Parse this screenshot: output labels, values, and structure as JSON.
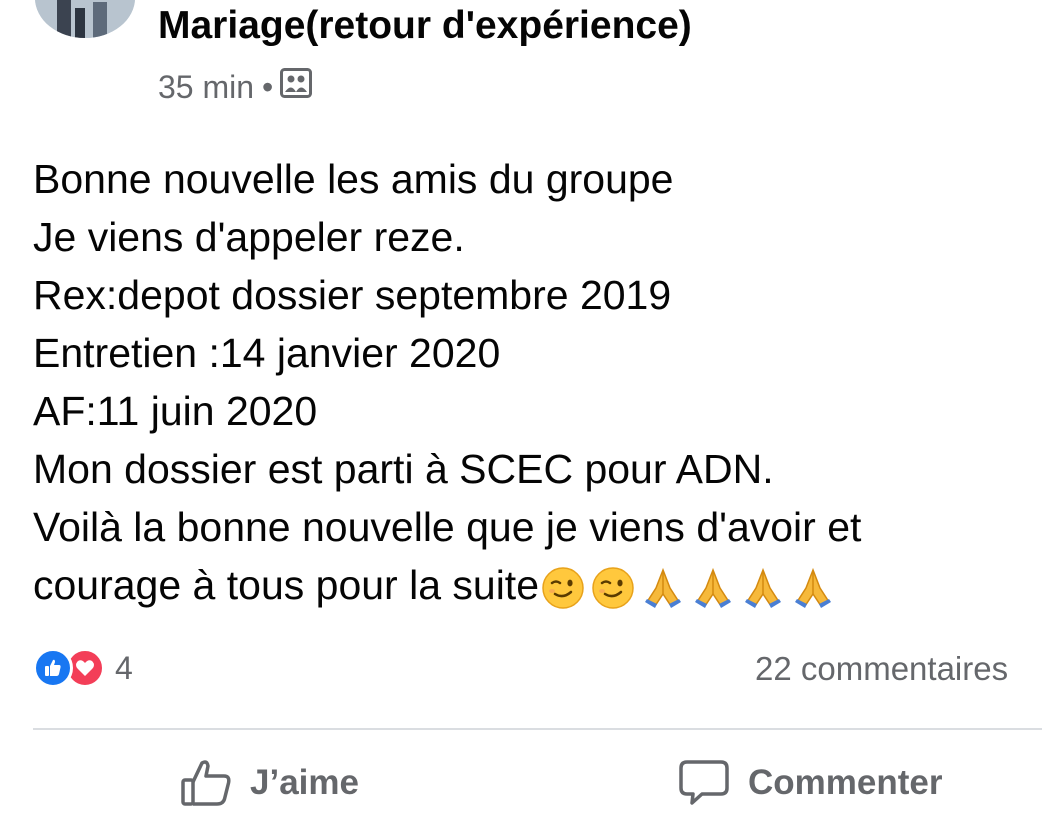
{
  "post": {
    "group_title": "Mariage(retour d'expérience)",
    "time": "35 min",
    "separator": "•",
    "privacy_icon": "group-privacy-icon",
    "text_lines": [
      "Bonne nouvelle les amis du groupe",
      "Je viens d'appeler reze.",
      "Rex:depot dossier septembre 2019",
      "Entretien :14 janvier 2020",
      "AF:11 juin 2020",
      "Mon dossier est parti à SCEC pour ADN.",
      "Voilà la bonne nouvelle que je viens d'avoir et",
      "courage à tous pour la suite"
    ],
    "emojis": [
      "winking-face",
      "winking-face",
      "folded-hands",
      "folded-hands",
      "folded-hands",
      "folded-hands"
    ]
  },
  "reactions": {
    "types": [
      "like",
      "love"
    ],
    "count": "4",
    "colors": {
      "like": "#1877f2",
      "love": "#f33e58"
    }
  },
  "comments": {
    "count_label": "22 commentaires"
  },
  "actions": {
    "like_label": "J’aime",
    "comment_label": "Commenter"
  },
  "colors": {
    "text": "#050505",
    "secondary": "#65676b",
    "divider": "#dadde1"
  }
}
